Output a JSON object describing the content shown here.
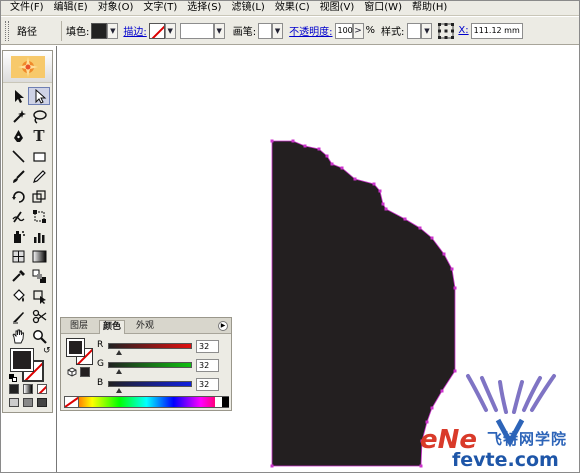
{
  "menubar": {
    "items": [
      "文件(F)",
      "编辑(E)",
      "对象(O)",
      "文字(T)",
      "选择(S)",
      "滤镜(L)",
      "效果(C)",
      "视图(V)",
      "窗口(W)",
      "帮助(H)"
    ]
  },
  "controlbar": {
    "selection_type": "路径",
    "fill_label": "填色:",
    "stroke_label": "描边:",
    "brush_label": "画笔:",
    "opacity_label": "不透明度:",
    "opacity_value": "100",
    "opacity_arrow": ">",
    "percent": "%",
    "style_label": "样式:",
    "x_label": "X:",
    "x_value": "111.12 mm"
  },
  "colors": {
    "fill": "#231f20",
    "stroke": "none",
    "anchor": "#cc33cc"
  },
  "color_panel": {
    "tabs": [
      "图层",
      "颜色",
      "外观"
    ],
    "active_tab": "颜色",
    "channels": [
      {
        "label": "R",
        "value": "32",
        "thumb": 0.125
      },
      {
        "label": "G",
        "value": "32",
        "thumb": 0.125
      },
      {
        "label": "B",
        "value": "32",
        "thumb": 0.125
      }
    ]
  },
  "watermark": {
    "logo_text": "eNe",
    "chinese_text": "飞特网学院",
    "site": "fevte.com"
  },
  "icons": {
    "selection": "selection-tool-icon",
    "direct_selection": "direct-selection-tool-icon",
    "magic_wand": "magic-wand-icon",
    "lasso": "lasso-icon",
    "pen": "pen-tool-icon",
    "type": "type-tool-icon",
    "line": "line-tool-icon",
    "rectangle": "rectangle-tool-icon",
    "paintbrush": "paintbrush-icon",
    "pencil": "pencil-icon",
    "rotate": "rotate-tool-icon",
    "scale": "scale-tool-icon",
    "warp": "warp-tool-icon",
    "free_transform": "free-transform-icon",
    "symbol_sprayer": "symbol-sprayer-icon",
    "graph": "graph-tool-icon",
    "mesh": "mesh-tool-icon",
    "gradient": "gradient-tool-icon",
    "eyedropper": "eyedropper-icon",
    "blend": "blend-tool-icon",
    "live_paint": "live-paint-bucket-icon",
    "live_paint_select": "live-paint-selection-icon",
    "slice": "slice-tool-icon",
    "scissors": "scissors-icon",
    "hand": "hand-tool-icon",
    "zoom": "zoom-tool-icon"
  }
}
